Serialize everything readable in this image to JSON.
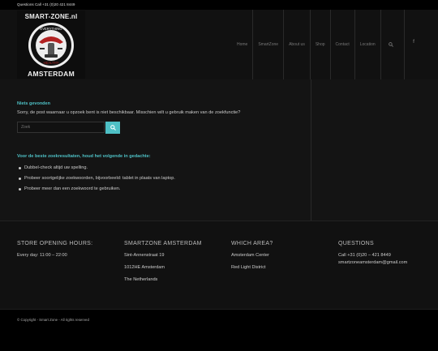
{
  "topbar": {
    "questions": "Questions Call +31 (0)20 421 8449"
  },
  "logo": {
    "brand": "SMART-ZONE.nl",
    "city": "AMSTERDAM",
    "badge_top": "EVERYTHING",
    "badge_bottom": "HEALTHY",
    "alt": "smartzone logo"
  },
  "nav": {
    "items": [
      "Home",
      "SmartZone",
      "About us",
      "Shop",
      "Contact",
      "Location"
    ],
    "search_icon": "search-icon",
    "facebook_icon": "facebook-icon",
    "facebook_glyph": "f"
  },
  "main": {
    "not_found_title": "Niets gevonden",
    "not_found_text": "Sorry, de post waarnaar u opzoek bent is niet beschikbaar. Misschien wilt u gebruik maken van de zoekfunctie?",
    "search_placeholder": "Zoek",
    "tips_title": "Voor de beste zoekresultaten, houd het volgende in gedachte:",
    "tips": [
      "Dubbel-check altijd uw spelling.",
      "Probeer soortgelijke zoekwoorden, bijvoorbeeld: tablet in plaats van laptop.",
      "Probeer meer dan een zoekwoord te gebruiken."
    ]
  },
  "footer": {
    "col1": {
      "title": "STORE OPENING HOURS:",
      "lines": [
        "Every day: 11:00 – 22:00"
      ]
    },
    "col2": {
      "title": "SMARTZONE AMSTERDAM",
      "lines": [
        "Sint-Annenstraat 19",
        "1012HE  Amsterdam",
        "The Netherlands"
      ]
    },
    "col3": {
      "title": "WHICH AREA?",
      "lines": [
        "Amsterdam Center",
        "Red Light District"
      ]
    },
    "col4": {
      "title": "QUESTIONS",
      "lines": [
        "Call +31 (0)20 – 421 8449",
        "smartzoneamsterdam@gmail.com"
      ]
    }
  },
  "socket": {
    "copyright": "© Copyright - Smart Zone - All rights reserved"
  },
  "colors": {
    "accent": "#4ec0c5",
    "background": "#141414",
    "footer": "#111111",
    "socket": "#000000"
  }
}
